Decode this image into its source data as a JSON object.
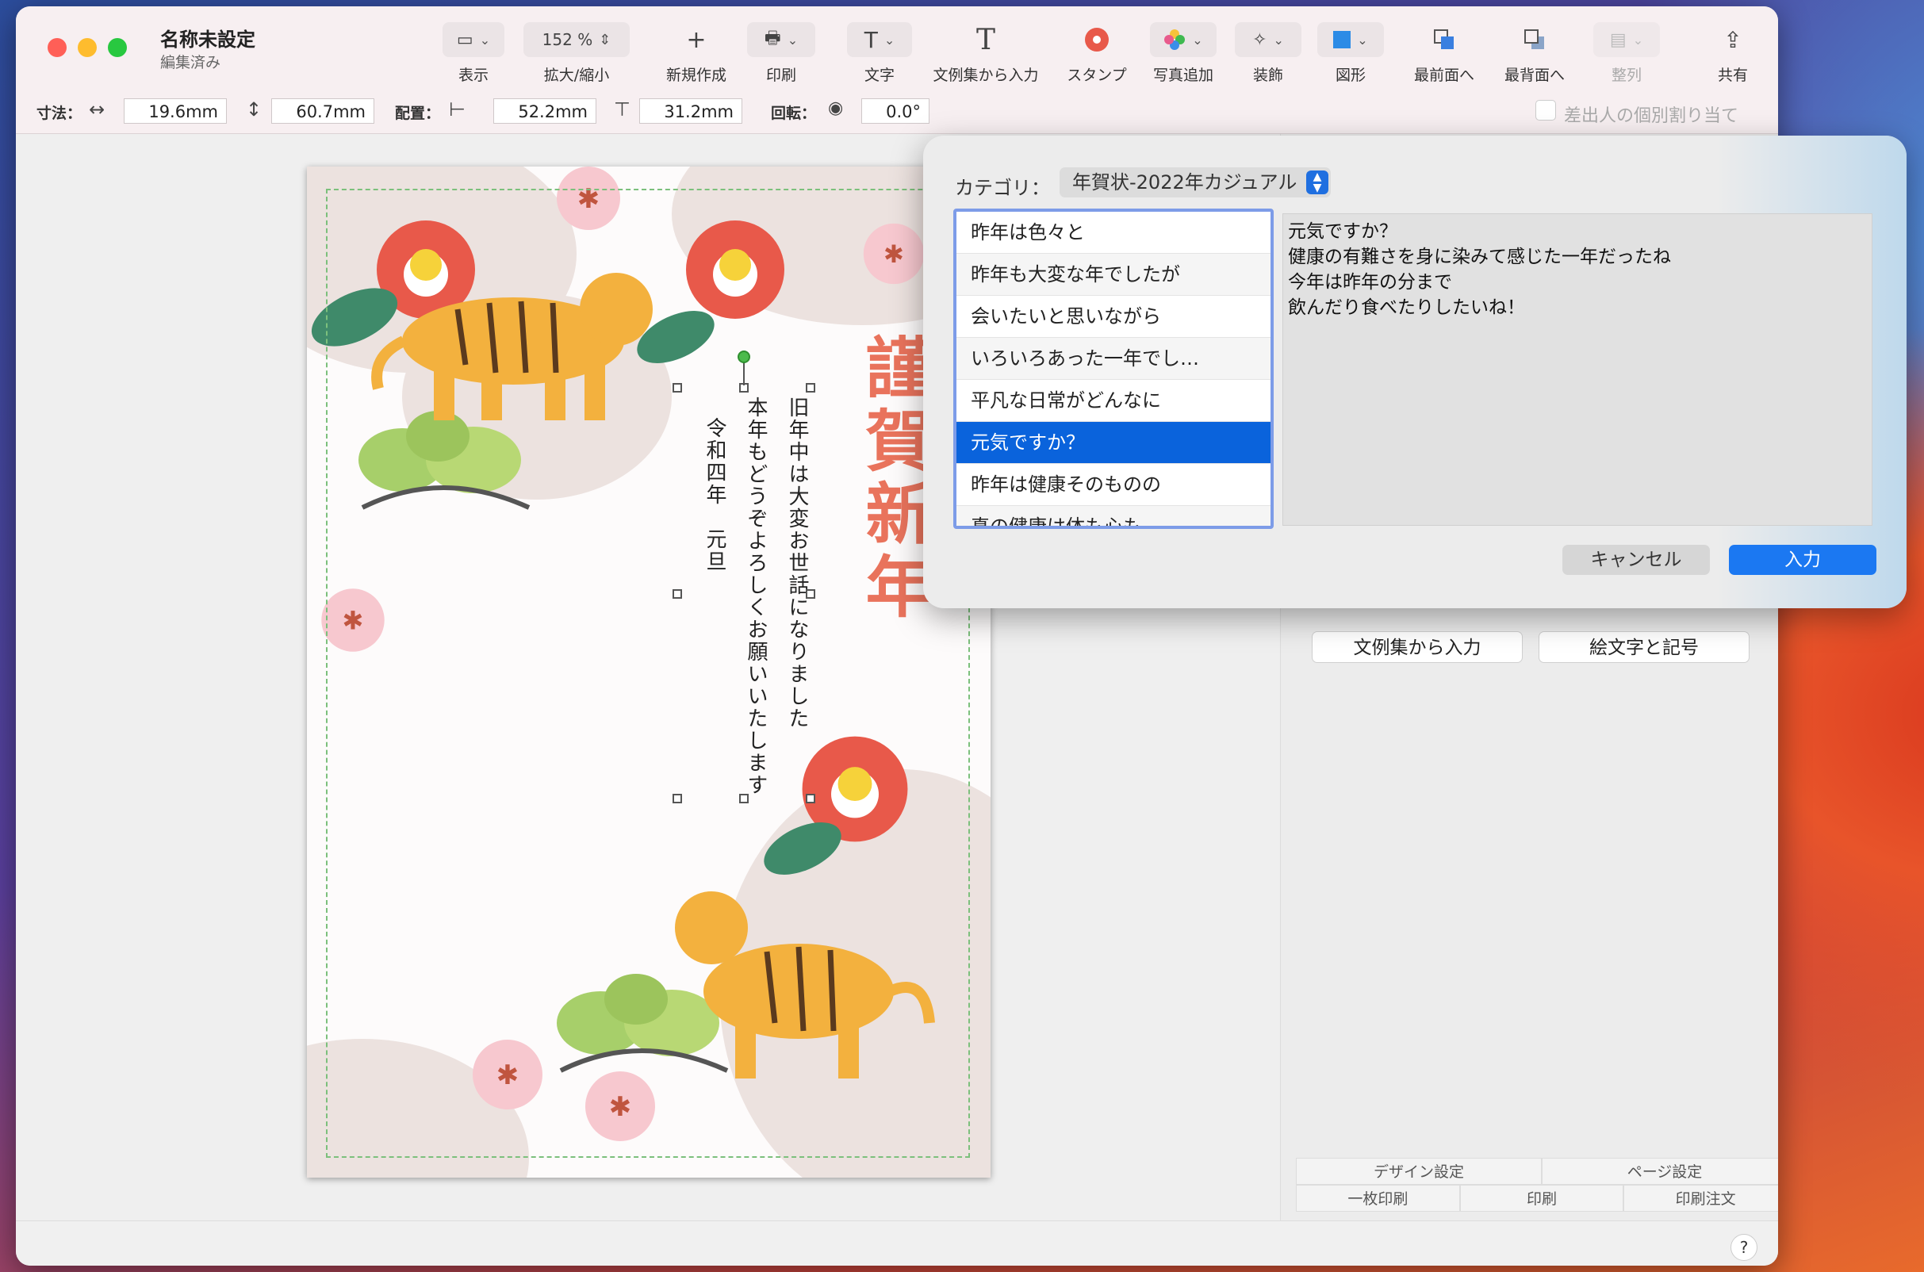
{
  "window": {
    "title": "名称未設定",
    "subtitle": "編集済み"
  },
  "toolbar": {
    "view_label": "表示",
    "zoom_value": "152 %",
    "zoom_label": "拡大/縮小",
    "new_label": "新規作成",
    "print_label": "印刷",
    "text_label": "文字",
    "phrase_label": "文例集から入力",
    "stamp_label": "スタンプ",
    "photo_label": "写真追加",
    "decor_label": "装飾",
    "shape_label": "図形",
    "front_label": "最前面へ",
    "back_label": "最背面へ",
    "align_label": "整列",
    "share_label": "共有",
    "text_icon_glyph": "T",
    "phrase_icon_glyph": "T",
    "new_icon_glyph": "+"
  },
  "propbar": {
    "size_label": "寸法：",
    "width_value": "19.6mm",
    "height_value": "60.7mm",
    "position_label": "配置：",
    "x_value": "52.2mm",
    "y_value": "31.2mm",
    "rotation_label": "回転：",
    "rotation_value": "0.0°",
    "sender_checkbox_label": "差出人の個別割り当て"
  },
  "card": {
    "greeting": "謹賀新年",
    "line1": "旧年中は大変お世話になりました",
    "line2": "本年もどうぞよろしくお願いいたします",
    "line3": "令和四年　元旦"
  },
  "popover": {
    "category_label": "カテゴリ：",
    "category_value": "年賀状-2022年カジュアル",
    "items": [
      "昨年は色々と",
      "昨年も大変な年でしたが",
      "会いたいと思いながら",
      "いろいろあった一年でし…",
      "平凡な日常がどんなに",
      "元気ですか？",
      "昨年は健康そのものの",
      "真の健康は体も心も"
    ],
    "selected_index": 5,
    "preview_lines": [
      "元気ですか？",
      "健康の有難さを身に染みて感じた一年だったね",
      "今年は昨年の分まで",
      "飲んだり食べたりしたいね！"
    ],
    "cancel_label": "キャンセル",
    "ok_label": "入力"
  },
  "sidebar": {
    "phrase_button": "文例集から入力",
    "emoji_button": "絵文字と記号",
    "design_settings": "デザイン設定",
    "page_settings": "ページ設定",
    "single_print": "一枚印刷",
    "print": "印刷",
    "print_order": "印刷注文"
  },
  "help_label": "?",
  "colors": {
    "accent": "#1b78f2",
    "selection": "#0a63dc",
    "greeting": "#e9735c",
    "camellia": "#e8594a",
    "plum": "#f7c8cf",
    "tiger": "#f3b13e"
  }
}
